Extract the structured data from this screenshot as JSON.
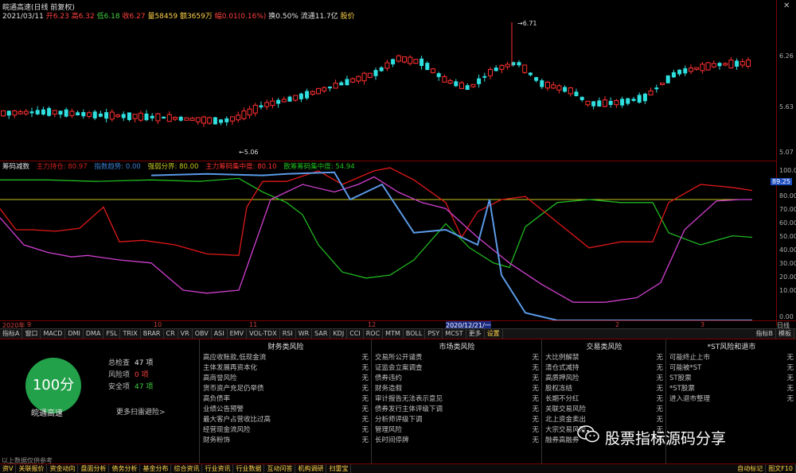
{
  "top_info": {
    "title": "皖通高速(日线 前复权)",
    "date": "2021/03/11",
    "open": "开6.23",
    "high": "高6.32",
    "low": "低6.18",
    "close": "收6.27",
    "volume": "量58459",
    "amount": "额3659万",
    "change": "幅0.01(0.16%)",
    "turnover": "换0.50%",
    "float": "流通11.7亿",
    "market_value": "股价"
  },
  "price_axis": {
    "labels": [
      "6.26",
      "5.63",
      "5.07"
    ]
  },
  "price_annotations": {
    "high_mark": "6.71",
    "low_mark": "5.06"
  },
  "indicator": {
    "name": "筹码减数",
    "legend": [
      {
        "label": "主力持仓: 80.97",
        "color": "#d02020"
      },
      {
        "label": "指数趋势: 0.00",
        "color": "#3a7fd0"
      },
      {
        "label": "强弱分界: 80.00",
        "color": "#c8c820"
      },
      {
        "label": "主力筹码集中度: 80.10",
        "color": "#ff3030"
      },
      {
        "label": "散筹筹码集中度: 54.94",
        "color": "#20c020"
      }
    ],
    "axis": [
      "100.0",
      "90.00",
      "80.00",
      "70.00",
      "60.00",
      "50.00",
      "40.00",
      "30.00",
      "20.00",
      "10.00",
      "0.00"
    ],
    "current_value": "89.25",
    "colors": {
      "red": "#e01818",
      "magenta": "#d040d0",
      "green": "#20b820",
      "blue": "#5a9ae8",
      "yellow": "#c8c820"
    }
  },
  "time_axis": {
    "labels": [
      "2020年",
      "9",
      "10",
      "11",
      "12",
      "2020/12/21/一",
      "2",
      "3",
      "日线"
    ]
  },
  "tabs": [
    "指标A",
    "窗口",
    "MACD",
    "DMI",
    "DMA",
    "FSL",
    "TRIX",
    "BRAR",
    "CR",
    "VR",
    "OBV",
    "ASI",
    "EMV",
    "VOL-TDX",
    "RSI",
    "WR",
    "SAR",
    "KDJ",
    "CCI",
    "ROC",
    "MTM",
    "BOLL",
    "PSY",
    "MCST",
    "更多",
    "设置"
  ],
  "tabs_right": [
    "指标B",
    "模板"
  ],
  "score": {
    "value": "100分",
    "stock": "皖通高速",
    "total_label": "总检查",
    "total_value": "47 项",
    "risk_label": "风险项",
    "risk_value": "0 项",
    "safe_label": "安全项",
    "safe_value": "47 项",
    "more": "更多扫雷避险>"
  },
  "risk_columns": [
    {
      "header": "财务类风险",
      "items": [
        "高应收账款,低现金流",
        "主体发展再资本化",
        "高商誉风险",
        "货币资产充足仍举债",
        "高负债率",
        "业绩公告预警",
        "最大客户占营收比过高",
        "经营现金流风险",
        "财务粉饰"
      ]
    },
    {
      "header": "市场类风险",
      "items": [
        "交易所公开谴责",
        "证监会立案调查",
        "债券违约",
        "财务造假",
        "审计报告无法表示意见",
        "债券发行主体评级下调",
        "分析师评级下调",
        "管理风险",
        "长时间停牌"
      ]
    },
    {
      "header": "交易类风险",
      "items": [
        "大比例解禁",
        "清仓式减持",
        "高质押风险",
        "股权冻结",
        "长期不分红",
        "关联交易风险",
        "北上资金卖出",
        "大宗交易风险",
        "融券高融券"
      ]
    },
    {
      "header": "*ST风险和退市",
      "items": [
        "可能终止上市",
        "可能被*ST",
        "ST股票",
        "*ST股票",
        "进入退市整理"
      ]
    }
  ],
  "risk_status": "无",
  "disclaimer": "以上数据仅供参考",
  "bottom_bar": [
    "资V",
    "关联报价",
    "资金动向",
    "盘面分析",
    "债务分析",
    "基金分布",
    "综合资讯",
    "行业资讯",
    "行业数据",
    "互动问答",
    "机构调研",
    "扫雷宝",
    "图文F10",
    "自动标记"
  ],
  "watermark": "股票指标源码分享"
}
